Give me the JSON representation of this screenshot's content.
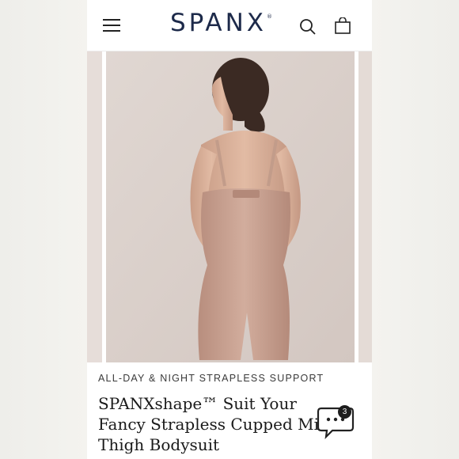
{
  "header": {
    "logo_text": "SPANX",
    "logo_mark": "®",
    "menu_icon": "hamburger-icon",
    "search_icon": "search-icon",
    "bag_icon": "shopping-bag-icon"
  },
  "product": {
    "subtitle": "ALL-DAY & NIGHT STRAPLESS SUPPORT",
    "title": "SPANXshape™ Suit Your Fancy Strapless Cupped Mid-Thigh Bodysuit"
  },
  "chat": {
    "icon": "chat-bubble-icon",
    "badge_count": "3"
  },
  "colors": {
    "brand": "#1d2a4a",
    "photo_bg": "#d9cfca",
    "garment": "#caa493"
  }
}
